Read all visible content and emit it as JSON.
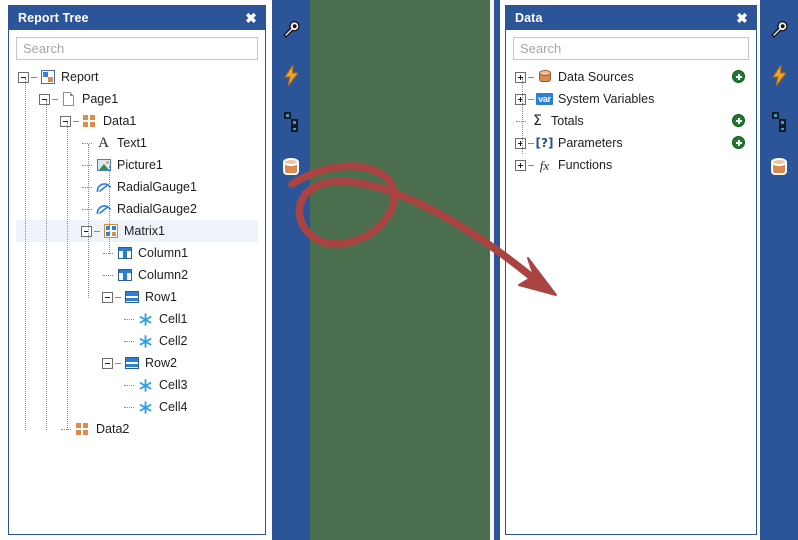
{
  "report_tree_panel": {
    "title": "Report Tree",
    "close_label": "✖",
    "search_placeholder": "Search",
    "nodes": [
      {
        "label": "Report",
        "icon": "report-icon",
        "depth": 0,
        "expander": "minus",
        "selected": false
      },
      {
        "label": "Page1",
        "icon": "page-icon",
        "depth": 1,
        "expander": "minus",
        "selected": false
      },
      {
        "label": "Data1",
        "icon": "data-band-icon",
        "depth": 2,
        "expander": "minus",
        "selected": false
      },
      {
        "label": "Text1",
        "icon": "text-icon",
        "depth": 3,
        "expander": "leaf",
        "selected": false
      },
      {
        "label": "Picture1",
        "icon": "picture-icon",
        "depth": 3,
        "expander": "leaf",
        "selected": false
      },
      {
        "label": "RadialGauge1",
        "icon": "radial-gauge-icon",
        "depth": 3,
        "expander": "leaf",
        "selected": false
      },
      {
        "label": "RadialGauge2",
        "icon": "radial-gauge-icon",
        "depth": 3,
        "expander": "leaf",
        "selected": false
      },
      {
        "label": "Matrix1",
        "icon": "matrix-icon",
        "depth": 3,
        "expander": "minus",
        "selected": true
      },
      {
        "label": "Column1",
        "icon": "column-icon",
        "depth": 4,
        "expander": "leaf",
        "selected": false
      },
      {
        "label": "Column2",
        "icon": "column-icon",
        "depth": 4,
        "expander": "leaf",
        "selected": false
      },
      {
        "label": "Row1",
        "icon": "row-icon",
        "depth": 4,
        "expander": "minus",
        "selected": false
      },
      {
        "label": "Cell1",
        "icon": "cell-icon",
        "depth": 5,
        "expander": "leaf",
        "selected": false
      },
      {
        "label": "Cell2",
        "icon": "cell-icon",
        "depth": 5,
        "expander": "leaf",
        "selected": false
      },
      {
        "label": "Row2",
        "icon": "row-icon",
        "depth": 4,
        "expander": "minus",
        "selected": false
      },
      {
        "label": "Cell3",
        "icon": "cell-icon",
        "depth": 5,
        "expander": "leaf",
        "selected": false
      },
      {
        "label": "Cell4",
        "icon": "cell-icon",
        "depth": 5,
        "expander": "leaf",
        "selected": false
      },
      {
        "label": "Data2",
        "icon": "data-band-icon",
        "depth": 2,
        "expander": "leaf",
        "selected": false
      }
    ]
  },
  "data_panel": {
    "title": "Data",
    "close_label": "✖",
    "search_placeholder": "Search",
    "nodes": [
      {
        "label": "Data Sources",
        "icon": "database-icon",
        "expander": "plus",
        "add_button": true
      },
      {
        "label": "System Variables",
        "icon": "var-icon",
        "expander": "plus",
        "add_button": false
      },
      {
        "label": "Totals",
        "icon": "sigma-icon",
        "expander": "leaf",
        "add_button": true
      },
      {
        "label": "Parameters",
        "icon": "parameter-icon",
        "expander": "plus",
        "add_button": true
      },
      {
        "label": "Functions",
        "icon": "fx-icon",
        "expander": "plus",
        "add_button": false
      }
    ],
    "var_icon_text": "var",
    "sigma_icon_text": "Σ",
    "parameter_icon_text": "[?]",
    "fx_icon_text": "fx"
  },
  "left_toolbar": {
    "buttons": [
      {
        "name": "properties-wrench-icon",
        "glyph": ""
      },
      {
        "name": "events-lightning-icon",
        "glyph": "⚡"
      },
      {
        "name": "report-tree-icon",
        "glyph": ""
      },
      {
        "name": "data-icon",
        "glyph": ""
      }
    ],
    "play_button_label": "▶"
  },
  "right_toolbar": {
    "buttons": [
      {
        "name": "properties-wrench-icon",
        "glyph": ""
      },
      {
        "name": "events-lightning-icon",
        "glyph": "⚡"
      },
      {
        "name": "report-tree-icon",
        "glyph": ""
      },
      {
        "name": "data-icon",
        "glyph": ""
      }
    ],
    "play_button_label": "▶"
  },
  "canvas": {
    "background_color": "#4a6e4e"
  },
  "annotation": {
    "type": "hand-drawn-arrow",
    "color": "#a94442",
    "description": "red curved arrow with loop pointing from left toolbar to data panel"
  },
  "colors": {
    "panel_header": "#2b5598",
    "accent_blue": "#2b7fd4",
    "add_green": "#1d7a2e",
    "canvas_green": "#4a6e4e",
    "annotation_red": "#a94442",
    "selection": "#eef3fa"
  }
}
